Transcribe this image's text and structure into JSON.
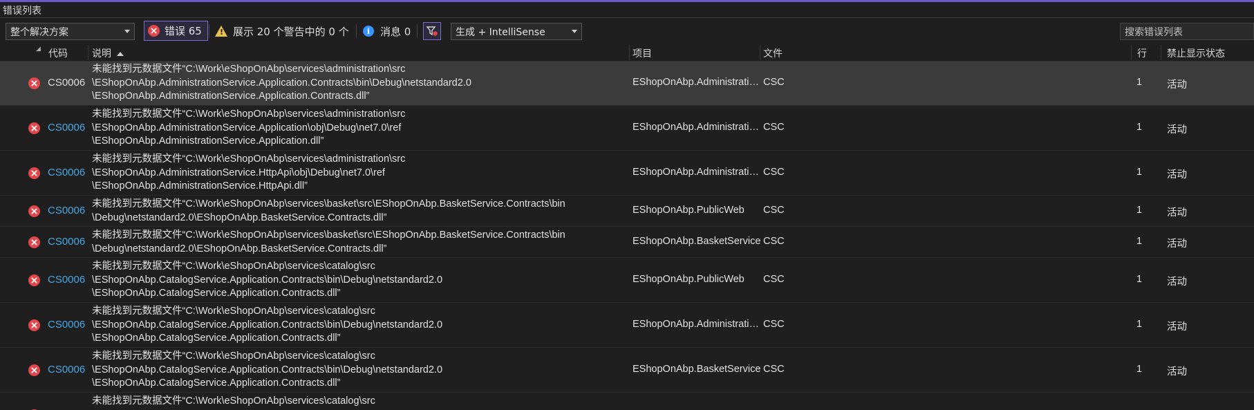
{
  "window": {
    "title": "错误列表"
  },
  "toolbar": {
    "scope": "整个解决方案",
    "errors_label": "错误 65",
    "warnings_label": "展示 20 个警告中的 0 个",
    "messages_label": "消息 0",
    "build_source": "生成 + IntelliSense",
    "search_placeholder": "搜索错误列表"
  },
  "columns": {
    "code": "代码",
    "description": "说明",
    "project": "项目",
    "file": "文件",
    "line": "行",
    "suppression": "禁止显示状态"
  },
  "rows": [
    {
      "code": "CS0006",
      "description": "未能找到元数据文件“C:\\Work\\eShopOnAbp\\services\\administration\\src\n\\EShopOnAbp.AdministrationService.Application.Contracts\\bin\\Debug\\netstandard2.0\n\\EShopOnAbp.AdministrationService.Application.Contracts.dll”",
      "project": "EShopOnAbp.AdministrationService",
      "file": "CSC",
      "line": "1",
      "state": "活动"
    },
    {
      "code": "CS0006",
      "description": "未能找到元数据文件“C:\\Work\\eShopOnAbp\\services\\administration\\src\n\\EShopOnAbp.AdministrationService.Application\\obj\\Debug\\net7.0\\ref\n\\EShopOnAbp.AdministrationService.Application.dll”",
      "project": "EShopOnAbp.AdministrationService",
      "file": "CSC",
      "line": "1",
      "state": "活动"
    },
    {
      "code": "CS0006",
      "description": "未能找到元数据文件“C:\\Work\\eShopOnAbp\\services\\administration\\src\n\\EShopOnAbp.AdministrationService.HttpApi\\obj\\Debug\\net7.0\\ref\n\\EShopOnAbp.AdministrationService.HttpApi.dll”",
      "project": "EShopOnAbp.AdministrationService",
      "file": "CSC",
      "line": "1",
      "state": "活动"
    },
    {
      "code": "CS0006",
      "description": "未能找到元数据文件“C:\\Work\\eShopOnAbp\\services\\basket\\src\\EShopOnAbp.BasketService.Contracts\\bin\n\\Debug\\netstandard2.0\\EShopOnAbp.BasketService.Contracts.dll”",
      "project": "EShopOnAbp.PublicWeb",
      "file": "CSC",
      "line": "1",
      "state": "活动"
    },
    {
      "code": "CS0006",
      "description": "未能找到元数据文件“C:\\Work\\eShopOnAbp\\services\\basket\\src\\EShopOnAbp.BasketService.Contracts\\bin\n\\Debug\\netstandard2.0\\EShopOnAbp.BasketService.Contracts.dll”",
      "project": "EShopOnAbp.BasketService",
      "file": "CSC",
      "line": "1",
      "state": "活动"
    },
    {
      "code": "CS0006",
      "description": "未能找到元数据文件“C:\\Work\\eShopOnAbp\\services\\catalog\\src\n\\EShopOnAbp.CatalogService.Application.Contracts\\bin\\Debug\\netstandard2.0\n\\EShopOnAbp.CatalogService.Application.Contracts.dll”",
      "project": "EShopOnAbp.PublicWeb",
      "file": "CSC",
      "line": "1",
      "state": "活动"
    },
    {
      "code": "CS0006",
      "description": "未能找到元数据文件“C:\\Work\\eShopOnAbp\\services\\catalog\\src\n\\EShopOnAbp.CatalogService.Application.Contracts\\bin\\Debug\\netstandard2.0\n\\EShopOnAbp.CatalogService.Application.Contracts.dll”",
      "project": "EShopOnAbp.AdministrationService",
      "file": "CSC",
      "line": "1",
      "state": "活动"
    },
    {
      "code": "CS0006",
      "description": "未能找到元数据文件“C:\\Work\\eShopOnAbp\\services\\catalog\\src\n\\EShopOnAbp.CatalogService.Application.Contracts\\bin\\Debug\\netstandard2.0\n\\EShopOnAbp.CatalogService.Application.Contracts.dll”",
      "project": "EShopOnAbp.BasketService",
      "file": "CSC",
      "line": "1",
      "state": "活动"
    },
    {
      "code": "CS0006",
      "description": "未能找到元数据文件“C:\\Work\\eShopOnAbp\\services\\catalog\\src",
      "project": "",
      "file": "",
      "line": "",
      "state": ""
    }
  ],
  "colors": {
    "accent": "#7a6cd1",
    "error": "#e2474c",
    "warning": "#e8c24b",
    "info": "#3794ff",
    "link": "#4aa7e6"
  },
  "icons": [
    "error-icon",
    "warning-icon",
    "info-icon",
    "filter-icon",
    "sort-ascending-icon",
    "chevron-down-icon"
  ]
}
